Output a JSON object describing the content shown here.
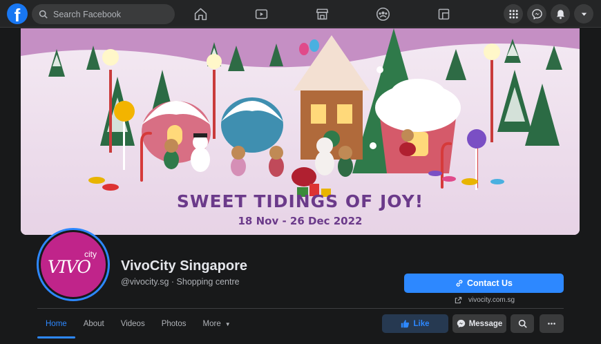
{
  "topbar": {
    "logo_letter": "f",
    "search_placeholder": "Search Facebook",
    "nav_icons": [
      "home-icon",
      "watch-icon",
      "marketplace-icon",
      "groups-icon",
      "gaming-icon"
    ],
    "right_icons": [
      "menu-grid-icon",
      "messenger-icon",
      "notifications-icon",
      "account-caret-icon"
    ]
  },
  "cover": {
    "title": "SWEET TIDINGS OF JOY!",
    "date": "18 Nov - 26 Dec 2022"
  },
  "profile": {
    "avatar_text_main": "VIVO",
    "avatar_text_sup": "city",
    "name": "VivoCity Singapore",
    "subtitle": "@vivocity.sg · Shopping centre",
    "avatar_color": "#c0248a"
  },
  "actions": {
    "contact_label": "Contact Us",
    "website": "vivocity.com.sg",
    "like_label": "Like",
    "message_label": "Message"
  },
  "tabs": [
    {
      "label": "Home",
      "active": true
    },
    {
      "label": "About"
    },
    {
      "label": "Videos"
    },
    {
      "label": "Photos"
    },
    {
      "label": "More"
    }
  ],
  "colors": {
    "accent": "#2d88ff",
    "background": "#18191a",
    "surface": "#242526"
  }
}
